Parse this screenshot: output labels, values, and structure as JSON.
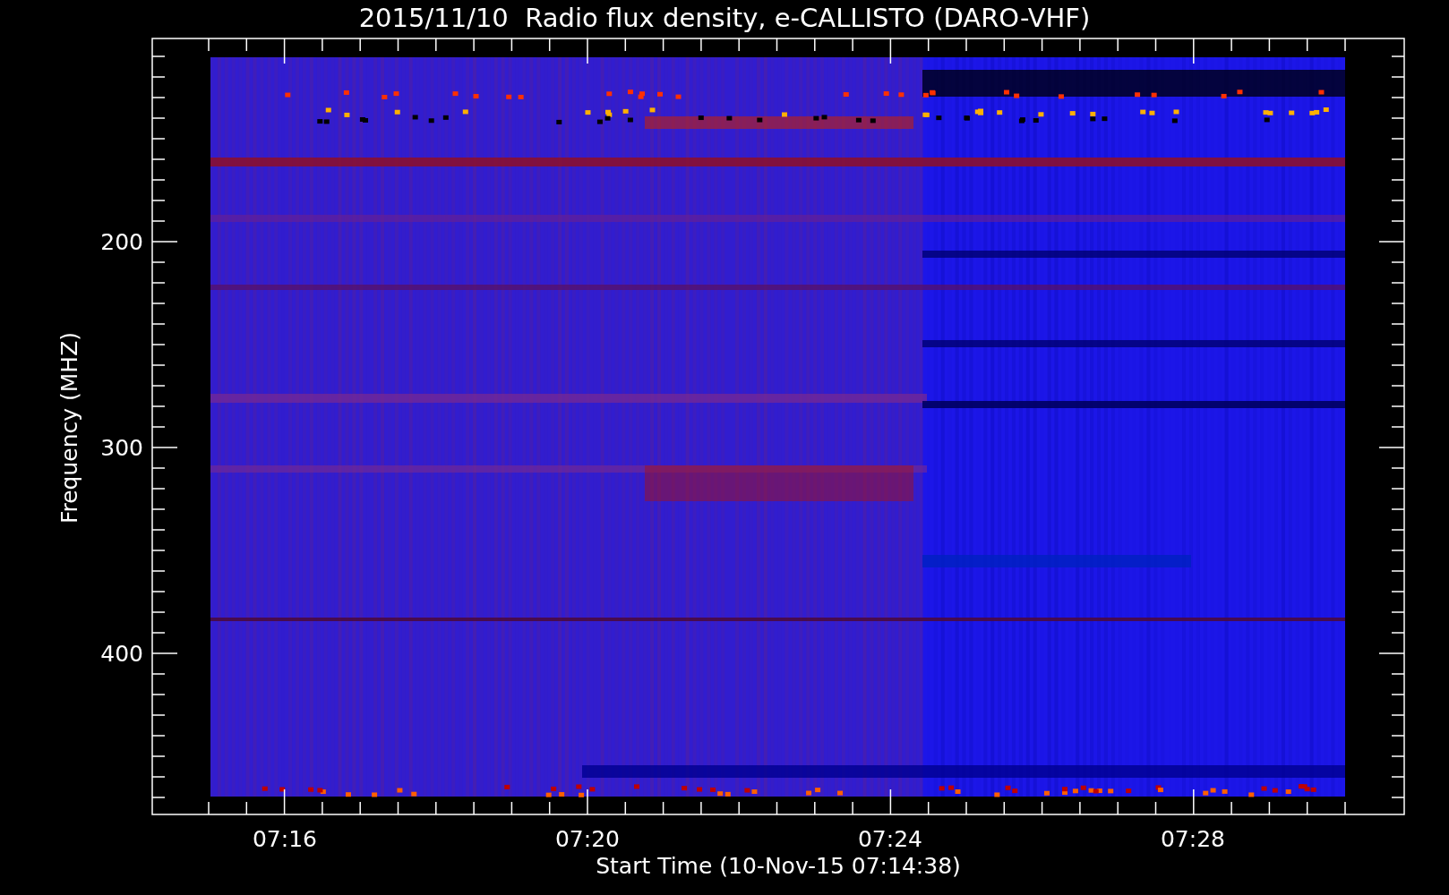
{
  "title": "2015/11/10  Radio flux density, e-CALLISTO (DARO-VHF)",
  "y_axis": {
    "label": "Frequency (MHZ)",
    "ticks": [
      "200",
      "300",
      "400"
    ]
  },
  "x_axis": {
    "label": "Start Time (10-Nov-15 07:14:38)",
    "ticks": [
      "07:16",
      "07:20",
      "07:24",
      "07:28"
    ]
  }
}
